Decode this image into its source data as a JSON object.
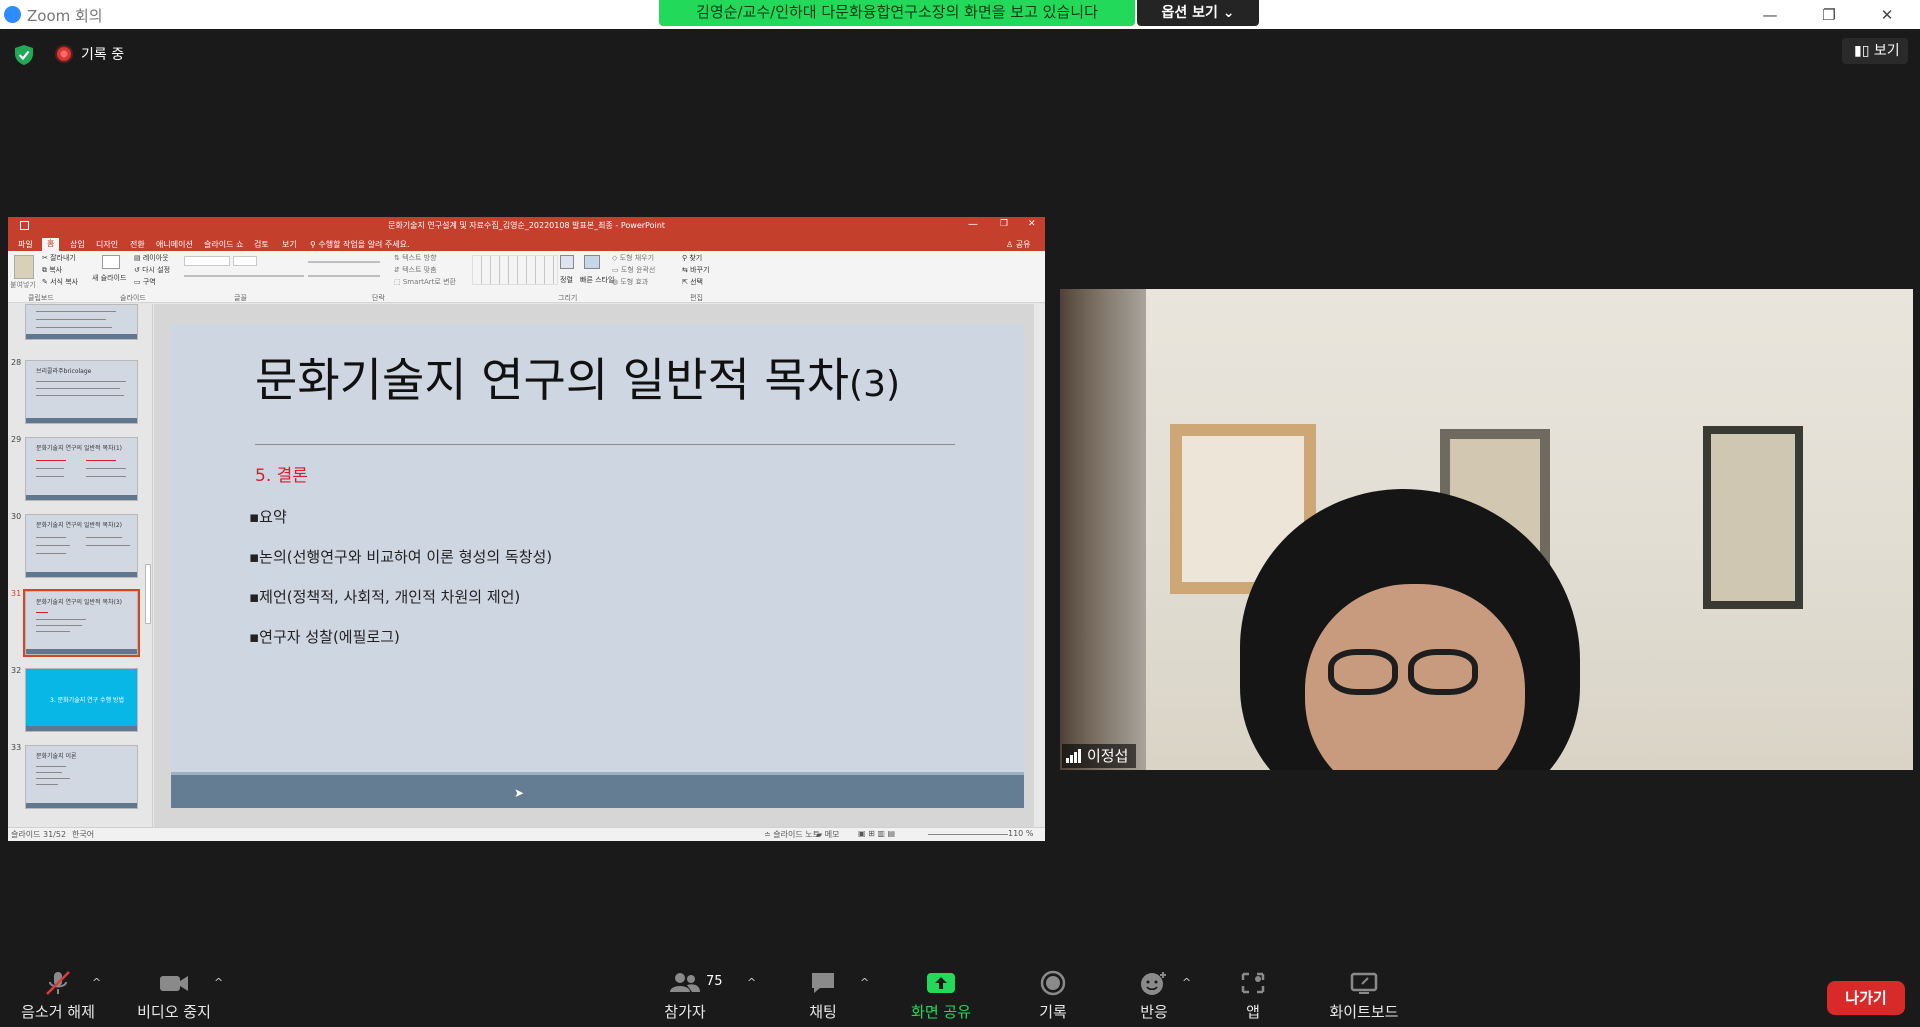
{
  "window": {
    "title": "Zoom 회의",
    "share_banner": "김영순/교수/인하대 다문화융합연구소장의 화면을 보고 있습니다",
    "view_options": "옵션 보기",
    "minimize": "—",
    "restore": "❐",
    "close": "✕"
  },
  "meeting": {
    "recording_label": "기록 중",
    "view_label": "보기"
  },
  "powerpoint": {
    "title": "문화기술지 연구설계 및 자료수집_김영순_20220108 발표본_최종 - PowerPoint",
    "tabs": [
      "파일",
      "홈",
      "삽입",
      "디자인",
      "전환",
      "애니메이션",
      "슬라이드 쇼",
      "검토",
      "보기"
    ],
    "tell_me": "수행할 작업을 알려 주세요.",
    "share": "공유",
    "ribbon_groups": [
      "클립보드",
      "슬라이드",
      "글꼴",
      "단락",
      "그리기",
      "편집"
    ],
    "ribbon_items": {
      "paste": "붙여넣기",
      "cut": "잘라내기",
      "copy": "복사",
      "format_painter": "서식 복사",
      "new_slide": "새 슬라이드",
      "layout": "레이아웃",
      "reset": "다시 설정",
      "section": "구역",
      "text_direction": "텍스트 방향",
      "align_text": "텍스트 맞춤",
      "smartart": "SmartArt로 변환",
      "arrange": "정렬",
      "quick_styles": "빠른 스타일",
      "shape_fill": "도형 채우기",
      "shape_outline": "도형 윤곽선",
      "shape_effects": "도형 효과",
      "find": "찾기",
      "replace": "바꾸기",
      "select": "선택"
    },
    "thumbnails": [
      {
        "num": "28",
        "title": "브리콜라주bricolage"
      },
      {
        "num": "29",
        "title": "문화기술지 연구의 일반적 목차(1)"
      },
      {
        "num": "30",
        "title": "문화기술지 연구의 일반적 목차(2)"
      },
      {
        "num": "31",
        "title": "문화기술지 연구의 일반적 목차(3)"
      },
      {
        "num": "32",
        "title": "3. 문화기술지 연구 수행 방법"
      },
      {
        "num": "33",
        "title": "문화기술지 이론"
      }
    ],
    "slide": {
      "title": "문화기술지 연구의 일반적 목차",
      "title_suffix": "(3)",
      "subtitle": "5. 결론",
      "bullets": [
        "요약",
        "논의(선행연구와 비교하여 이론 형성의 독창성)",
        "제언(정책적, 사회적, 개인적 차원의 제언)",
        "연구자 성찰(에필로그)"
      ]
    },
    "status": {
      "slide_count": "슬라이드 31/52",
      "language": "한국어",
      "notes": "슬라이드 노트",
      "comments": "메모",
      "zoom": "110 %"
    }
  },
  "video": {
    "participant_name": "이정섭"
  },
  "toolbar": {
    "mute": "음소거 해제",
    "video": "비디오 중지",
    "participants": "참가자",
    "participants_count": "75",
    "chat": "채팅",
    "share": "화면 공유",
    "record": "기록",
    "reactions": "반응",
    "apps": "앱",
    "whiteboard": "화이트보드",
    "leave": "나가기"
  },
  "colors": {
    "banner_green": "#23d959",
    "ppt_red": "#c4402d",
    "share_green": "#23d959",
    "leave_red": "#d92a2a",
    "slide_subtitle_red": "#d1202c"
  }
}
